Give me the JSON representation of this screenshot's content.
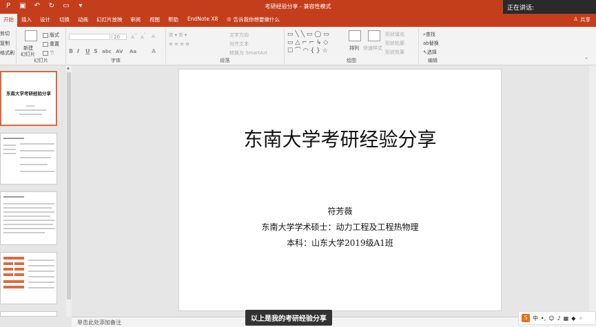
{
  "titlebar": {
    "doc_title": "考研经验分享 - 兼容性模式",
    "speaking": "正在讲话:"
  },
  "qat": {
    "icons": [
      "powerpoint-logo-icon",
      "save-icon",
      "undo-icon",
      "redo-icon",
      "start-slideshow-icon",
      "customize-qat-icon"
    ]
  },
  "tabs": [
    {
      "label": "开始",
      "active": true
    },
    {
      "label": "插入"
    },
    {
      "label": "设计"
    },
    {
      "label": "切换"
    },
    {
      "label": "动画"
    },
    {
      "label": "幻灯片放映"
    },
    {
      "label": "审阅"
    },
    {
      "label": "视图"
    },
    {
      "label": "帮助"
    },
    {
      "label": "EndNote X8"
    }
  ],
  "tellme": "告诉我你想要做什么",
  "share": "共享",
  "ribbon": {
    "clipboard": {
      "cut": "剪切",
      "copy": "复制",
      "format_painter": "格式刷",
      "label": ""
    },
    "slides": {
      "new_slide": "新建",
      "new_slide2": "幻灯片",
      "layout": "版式",
      "reset": "重置",
      "section": "节",
      "label": "幻灯片"
    },
    "font": {
      "size": "20",
      "format_buttons": [
        "B",
        "I",
        "U",
        "S",
        "abc",
        "AV",
        "Aa",
        "A"
      ],
      "label": "字体"
    },
    "paragraph": {
      "text_direction": "文字方向",
      "align_text": "对齐文本",
      "smartart": "转换为 SmartArt",
      "label": "段落"
    },
    "drawing": {
      "arrange": "排列",
      "quick_styles": "快速样式",
      "shape_fill": "形状填充",
      "shape_outline": "形状轮廓",
      "shape_effects": "形状效果",
      "label": "绘图"
    },
    "editing": {
      "find": "查找",
      "replace": "替换",
      "select": "选择",
      "label": "编辑"
    }
  },
  "thumbnails": {
    "slide1_title": "东南大学考研经验分享"
  },
  "slide": {
    "title": "东南大学考研经验分享",
    "author": "符芳薇",
    "line1": "东南大学学术硕士：动力工程及工程热物理",
    "line2": "本科：山东大学2019级A1班"
  },
  "notes_placeholder": "单击此处添加备注",
  "subtitle": "以上是我的考研经验分享",
  "ime": {
    "lang": "中"
  },
  "colors": {
    "accent": "#c43e1c",
    "selected_thumb_border": "#d9673f"
  }
}
